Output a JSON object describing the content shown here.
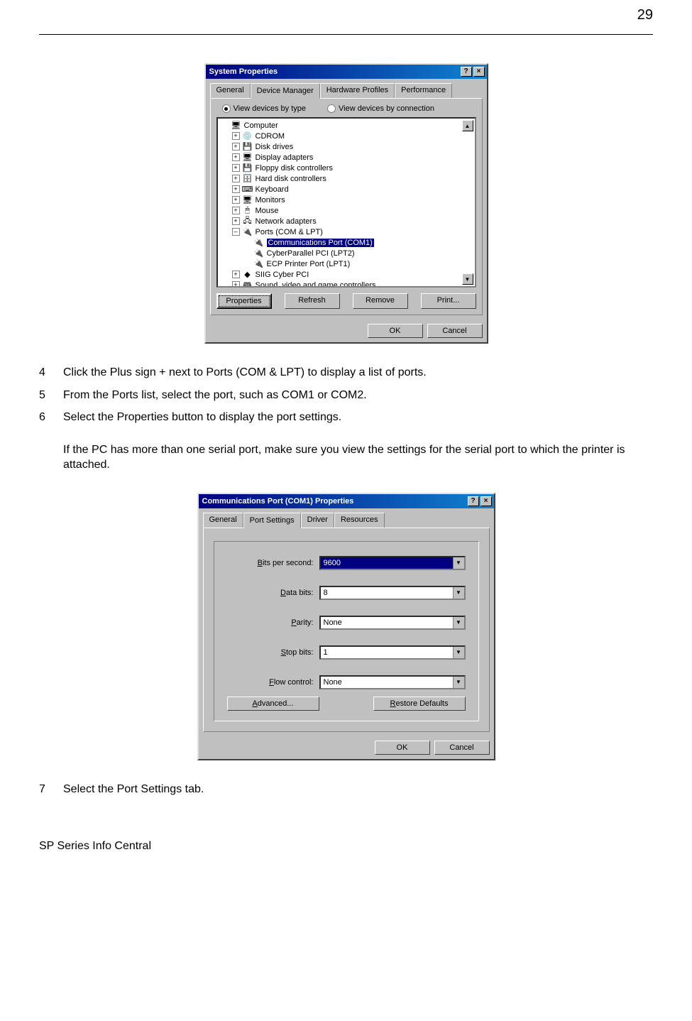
{
  "page": {
    "number": "29",
    "footer": "SP Series Info Central"
  },
  "dialog1": {
    "title": "System Properties",
    "tabs": [
      "General",
      "Device Manager",
      "Hardware Profiles",
      "Performance"
    ],
    "active_tab": 1,
    "radio1": "View devices by type",
    "radio2": "View devices by connection",
    "tree": [
      {
        "indent": 0,
        "exp": "",
        "icon": "🖥",
        "label": "Computer"
      },
      {
        "indent": 1,
        "exp": "+",
        "icon": "💿",
        "label": "CDROM"
      },
      {
        "indent": 1,
        "exp": "+",
        "icon": "💾",
        "label": "Disk drives"
      },
      {
        "indent": 1,
        "exp": "+",
        "icon": "🖥",
        "label": "Display adapters"
      },
      {
        "indent": 1,
        "exp": "+",
        "icon": "💾",
        "label": "Floppy disk controllers"
      },
      {
        "indent": 1,
        "exp": "+",
        "icon": "🗄",
        "label": "Hard disk controllers"
      },
      {
        "indent": 1,
        "exp": "+",
        "icon": "⌨",
        "label": "Keyboard"
      },
      {
        "indent": 1,
        "exp": "+",
        "icon": "🖥",
        "label": "Monitors"
      },
      {
        "indent": 1,
        "exp": "+",
        "icon": "🖱",
        "label": "Mouse"
      },
      {
        "indent": 1,
        "exp": "+",
        "icon": "🖧",
        "label": "Network adapters"
      },
      {
        "indent": 1,
        "exp": "–",
        "icon": "🔌",
        "label": "Ports (COM & LPT)"
      },
      {
        "indent": 2,
        "exp": "",
        "icon": "🔌",
        "label": "Communications Port (COM1)",
        "selected": true
      },
      {
        "indent": 2,
        "exp": "",
        "icon": "🔌",
        "label": "CyberParallel PCI (LPT2)"
      },
      {
        "indent": 2,
        "exp": "",
        "icon": "🔌",
        "label": "ECP Printer Port (LPT1)"
      },
      {
        "indent": 1,
        "exp": "+",
        "icon": "◆",
        "label": "SIIG Cyber PCI"
      },
      {
        "indent": 1,
        "exp": "+",
        "icon": "🎮",
        "label": "Sound, video and game controllers"
      }
    ],
    "buttons": [
      "Properties",
      "Refresh",
      "Remove",
      "Print..."
    ],
    "ok": "OK",
    "cancel": "Cancel"
  },
  "steps": [
    {
      "n": "4",
      "t": "Click the Plus sign + next to Ports (COM & LPT) to display a list of ports."
    },
    {
      "n": "5",
      "t": "From the Ports list, select the port, such as COM1 or COM2."
    },
    {
      "n": "6",
      "t": "Select the Properties button to display the port settings."
    }
  ],
  "note": "If the PC has more than one serial port, make sure you view the settings for the serial port to which the printer is attached.",
  "dialog2": {
    "title": "Communications Port (COM1) Properties",
    "tabs": [
      "General",
      "Port Settings",
      "Driver",
      "Resources"
    ],
    "active_tab": 1,
    "fields": {
      "bits": {
        "label": "Bits per second:",
        "value": "9600",
        "hl": true
      },
      "databits": {
        "label": "Data bits:",
        "value": "8"
      },
      "parity": {
        "label": "Parity:",
        "value": "None"
      },
      "stopbits": {
        "label": "Stop bits:",
        "value": "1"
      },
      "flow": {
        "label": "Flow control:",
        "value": "None"
      }
    },
    "advanced": "Advanced...",
    "restore": "Restore Defaults",
    "ok": "OK",
    "cancel": "Cancel"
  },
  "step7": {
    "n": "7",
    "t": "Select the Port Settings tab."
  }
}
